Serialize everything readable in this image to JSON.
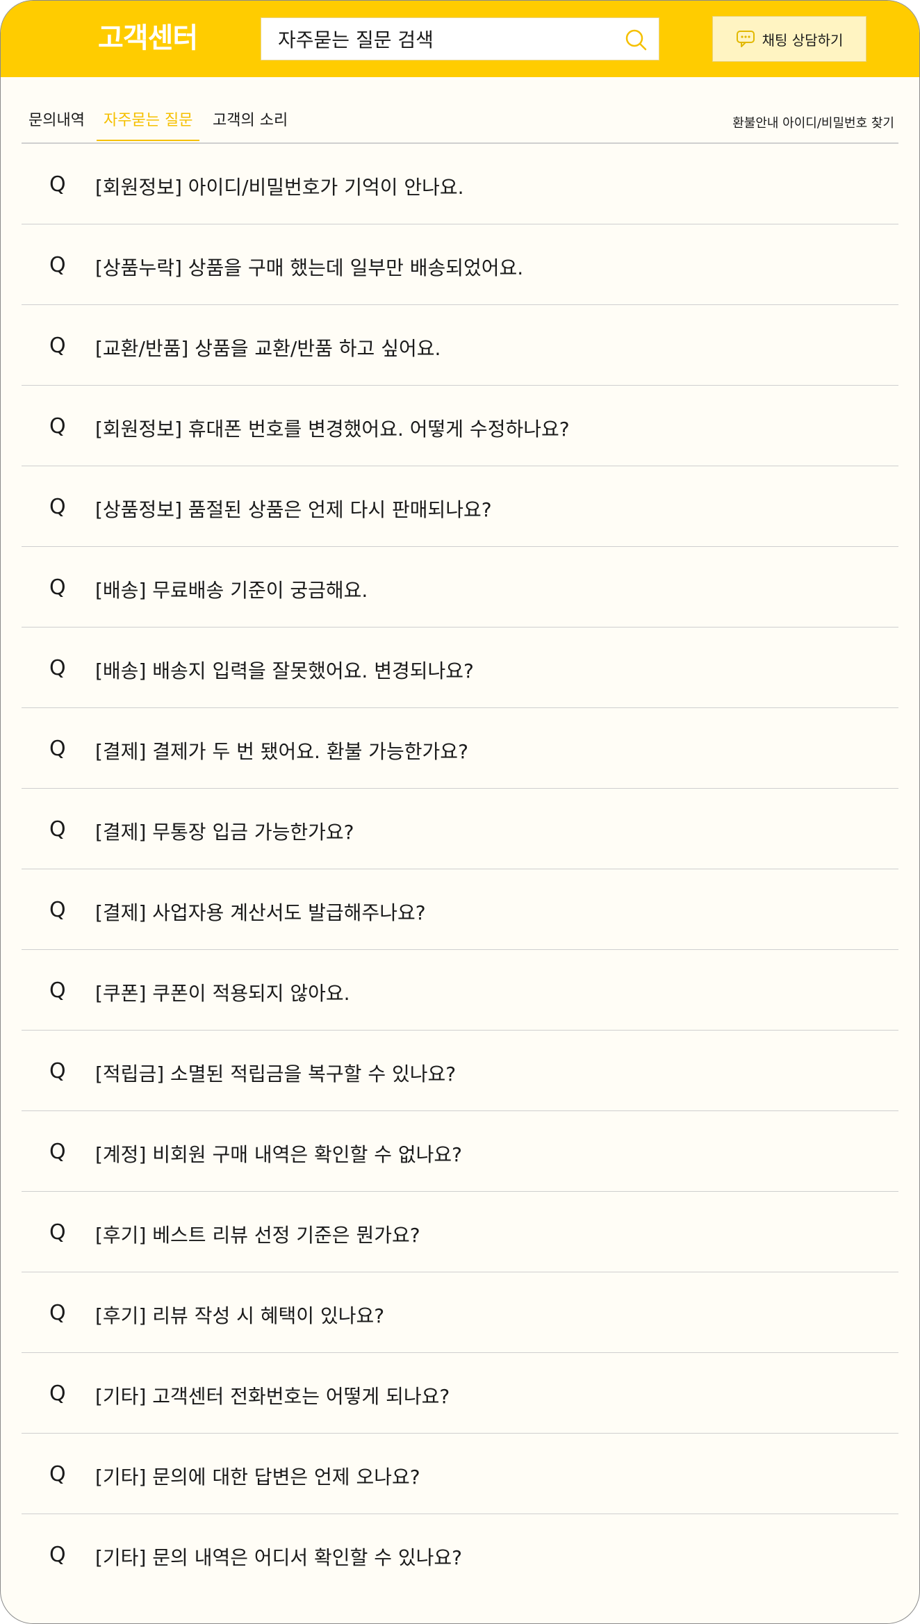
{
  "header": {
    "brand": "고객센터",
    "search_placeholder": "자주묻는 질문 검색",
    "search_icon": "search-icon",
    "chat_button_label": "채팅 상담하기",
    "chat_icon": "chat-bubble-icon",
    "accent_color": "#ffcc00"
  },
  "tabs": [
    {
      "label": "문의내역",
      "active": false
    },
    {
      "label": "자주묻는 질문",
      "active": true
    },
    {
      "label": "고객의 소리",
      "active": false
    }
  ],
  "right_links": "환불안내 아이디/비밀번호 찾기",
  "faq": {
    "q_mark": "Q",
    "items": [
      "[회원정보] 아이디/비밀번호가 기억이 안나요.",
      "[상품누락] 상품을 구매 했는데 일부만 배송되었어요.",
      "[교환/반품] 상품을 교환/반품 하고 싶어요.",
      "[회원정보] 휴대폰 번호를 변경했어요. 어떻게 수정하나요?",
      "[상품정보] 품절된 상품은 언제 다시 판매되나요?",
      "[배송] 무료배송 기준이 궁금해요.",
      "[배송] 배송지 입력을 잘못했어요. 변경되나요?",
      "[결제] 결제가 두 번 됐어요. 환불 가능한가요?",
      "[결제] 무통장 입금 가능한가요?",
      "[결제] 사업자용 계산서도 발급해주나요?",
      "[쿠폰] 쿠폰이 적용되지 않아요.",
      "[적립금] 소멸된 적립금을 복구할 수 있나요?",
      "[계정] 비회원 구매 내역은 확인할 수 없나요?",
      "[후기] 베스트 리뷰 선정 기준은 뭔가요?",
      "[후기] 리뷰 작성 시 혜택이 있나요?",
      "[기타] 고객센터 전화번호는 어떻게 되나요?",
      "[기타] 문의에 대한 답변은 언제 오나요?",
      "[기타] 문의 내역은 어디서 확인할 수 있나요?"
    ]
  }
}
